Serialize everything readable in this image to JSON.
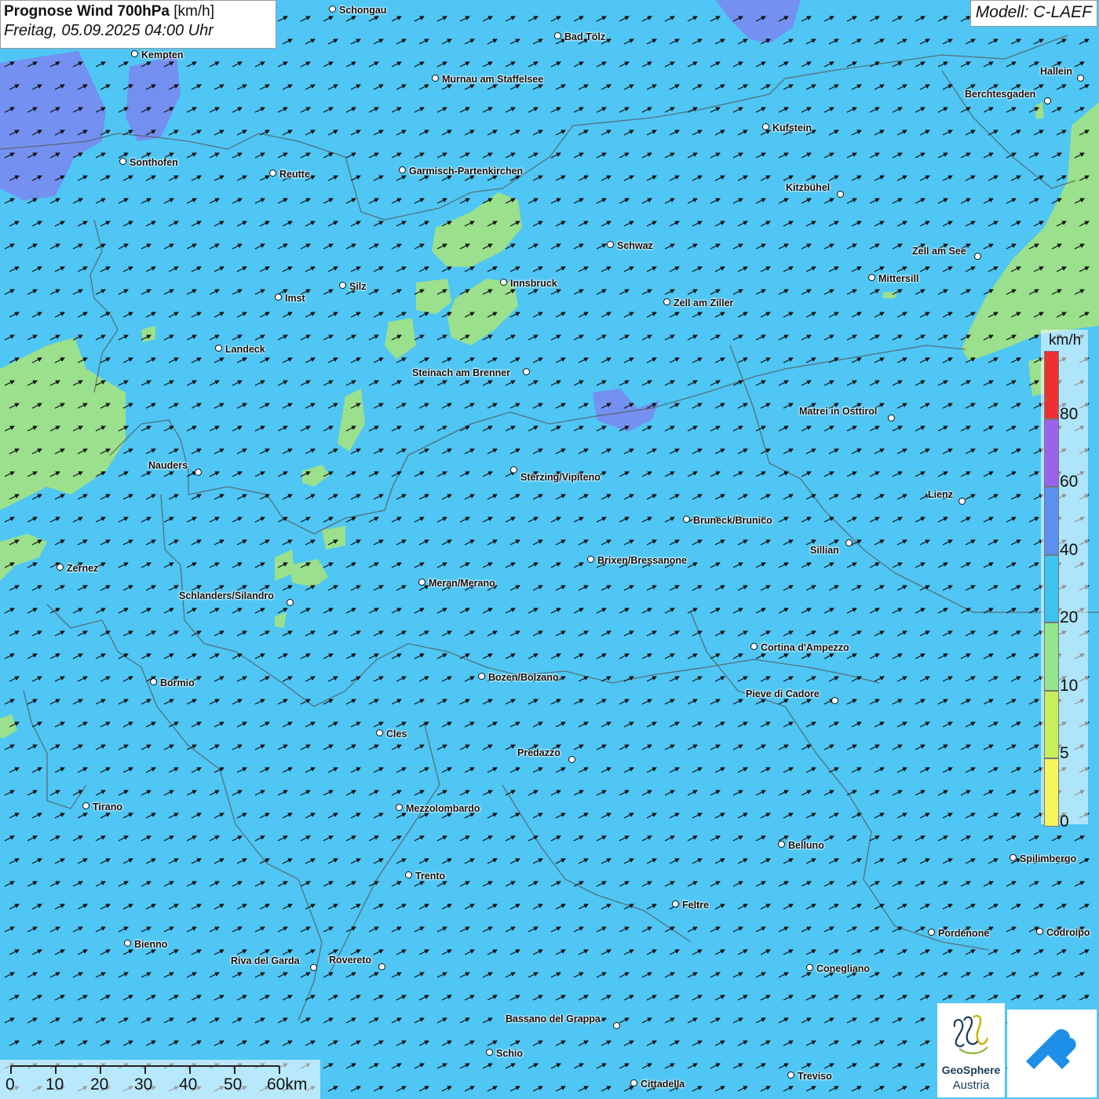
{
  "title": {
    "bold": "Prognose Wind 700hPa",
    "unit": "[km/h]",
    "datetime": "Freitag, 05.09.2025 04:00 Uhr"
  },
  "model": "Modell: C-LAEF",
  "cities": [
    {
      "id": "schongau",
      "name": "Schongau"
    },
    {
      "id": "bad-toelz",
      "name": "Bad Tölz"
    },
    {
      "id": "kempten",
      "name": "Kempten"
    },
    {
      "id": "murnau",
      "name": "Murnau am Staffelsee"
    },
    {
      "id": "hallein",
      "name": "Hallein"
    },
    {
      "id": "berchtesgaden",
      "name": "Berchtesgaden"
    },
    {
      "id": "kufstein",
      "name": "Kufstein"
    },
    {
      "id": "sonthofen",
      "name": "Sonthofen"
    },
    {
      "id": "reutte",
      "name": "Reutte"
    },
    {
      "id": "garmisch",
      "name": "Garmisch-Partenkirchen"
    },
    {
      "id": "kitzbuehel",
      "name": "Kitzbühel"
    },
    {
      "id": "schwaz",
      "name": "Schwaz"
    },
    {
      "id": "zell-am-see",
      "name": "Zell am See"
    },
    {
      "id": "mittersill",
      "name": "Mittersill"
    },
    {
      "id": "innsbruck",
      "name": "Innsbruck"
    },
    {
      "id": "silz",
      "name": "Silz"
    },
    {
      "id": "imst",
      "name": "Imst"
    },
    {
      "id": "zell-am-ziller",
      "name": "Zell am Ziller"
    },
    {
      "id": "landeck",
      "name": "Landeck"
    },
    {
      "id": "steinach",
      "name": "Steinach am Brenner"
    },
    {
      "id": "matrei",
      "name": "Matrei in Osttirol"
    },
    {
      "id": "nauders",
      "name": "Nauders"
    },
    {
      "id": "sterzing",
      "name": "Sterzing/Vipiteno"
    },
    {
      "id": "lienz",
      "name": "Lienz"
    },
    {
      "id": "bruneck",
      "name": "Bruneck/Brunico"
    },
    {
      "id": "sillian",
      "name": "Sillian"
    },
    {
      "id": "brixen",
      "name": "Brixen/Bressanone"
    },
    {
      "id": "zernez",
      "name": "Zernez"
    },
    {
      "id": "meran",
      "name": "Meran/Merano"
    },
    {
      "id": "schlanders",
      "name": "Schlanders/Silandro"
    },
    {
      "id": "cortina",
      "name": "Cortina d'Ampezzo"
    },
    {
      "id": "bozen",
      "name": "Bozen/Bolzano"
    },
    {
      "id": "bormio",
      "name": "Bormio"
    },
    {
      "id": "pieve",
      "name": "Pieve di Cadore"
    },
    {
      "id": "cles",
      "name": "Cles"
    },
    {
      "id": "predazzo",
      "name": "Predazzo"
    },
    {
      "id": "tirano",
      "name": "Tirano"
    },
    {
      "id": "mezzolombardo",
      "name": "Mezzolombardo"
    },
    {
      "id": "belluno",
      "name": "Belluno"
    },
    {
      "id": "spilimbergo",
      "name": "Spilimbergo"
    },
    {
      "id": "trento",
      "name": "Trento"
    },
    {
      "id": "feltre",
      "name": "Feltre"
    },
    {
      "id": "pordenone",
      "name": "Pordenone"
    },
    {
      "id": "codroipo",
      "name": "Codroipo"
    },
    {
      "id": "bienno",
      "name": "Bienno"
    },
    {
      "id": "riva",
      "name": "Riva del Garda"
    },
    {
      "id": "rovereto",
      "name": "Rovereto"
    },
    {
      "id": "conegliano",
      "name": "Conegliano"
    },
    {
      "id": "bassano",
      "name": "Bassano del Grappa"
    },
    {
      "id": "schio",
      "name": "Schio"
    },
    {
      "id": "treviso",
      "name": "Treviso"
    },
    {
      "id": "cittadella",
      "name": "Cittadella"
    }
  ],
  "legend": {
    "unit": "km/h",
    "classes": [
      {
        "label": "80",
        "color": "#ee3030"
      },
      {
        "label": "60",
        "color": "#9b62ec"
      },
      {
        "label": "40",
        "color": "#5b8ff0"
      },
      {
        "label": "20",
        "color": "#3cc3ef"
      },
      {
        "label": "10",
        "color": "#93e68a"
      },
      {
        "label": "5",
        "color": "#c8ef5a"
      },
      {
        "label": "0",
        "color": "#f6f55c"
      }
    ]
  },
  "scalebar": {
    "labels": [
      "0",
      "10",
      "20",
      "30",
      "40",
      "50",
      "60km"
    ]
  },
  "logo": {
    "line1": "GeoSphere",
    "line2": "Austria"
  },
  "colors": {
    "base": "#4fc6f4",
    "calm": "#9be08c",
    "strong": "#6d7ff0"
  }
}
